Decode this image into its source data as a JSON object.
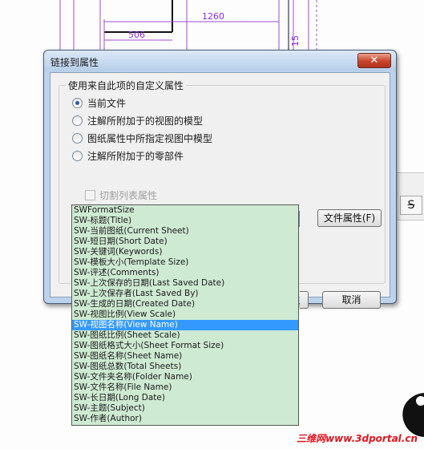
{
  "background": {
    "dimension_top": "1260",
    "dimension_left": "506",
    "dimension_side": "15"
  },
  "dialog": {
    "title": "链接到属性",
    "close_glyph": "✕",
    "group_title": "使用来自此项的自定义属性",
    "options": [
      {
        "label": "当前文件",
        "selected": true
      },
      {
        "label": "注解所附加于的视图的模型",
        "selected": false
      },
      {
        "label": "图纸属性中所指定视图中模型",
        "selected": false
      },
      {
        "label": "注解所附加于的零部件",
        "selected": false
      }
    ],
    "checkbox_label": "切割列表属性",
    "combo_value": "",
    "file_props_button": "文件属性(F)",
    "cancel_button": "取消"
  },
  "dropdown": {
    "selected_index": 11,
    "items": [
      "SWFormatSize",
      "SW-标题(Title)",
      "SW-当前图纸(Current Sheet)",
      "SW-短日期(Short Date)",
      "SW-关键词(Keywords)",
      "SW-模板大小(Template Size)",
      "SW-评述(Comments)",
      "SW-上次保存的日期(Last Saved Date)",
      "SW-上次保存者(Last Saved By)",
      "SW-生成的日期(Created Date)",
      "SW-视图比例(View Scale)",
      "SW-视图名称(View Name)",
      "SW-图纸比例(Sheet Scale)",
      "SW-图纸格式大小(Sheet Format Size)",
      "SW-图纸名称(Sheet Name)",
      "SW-图纸总数(Total Sheets)",
      "SW-文件夹名称(Folder Name)",
      "SW-文件名称(File Name)",
      "SW-长日期(Long Date)",
      "SW-主题(Subject)",
      "SW-作者(Author)"
    ]
  },
  "side_toolbar": {
    "strike_label": "S"
  },
  "watermark": "三维网www.3dportal.cn",
  "colors": {
    "selection": "#3399ff",
    "list_bg": "#ceead2",
    "dimension": "#8a2be2"
  }
}
